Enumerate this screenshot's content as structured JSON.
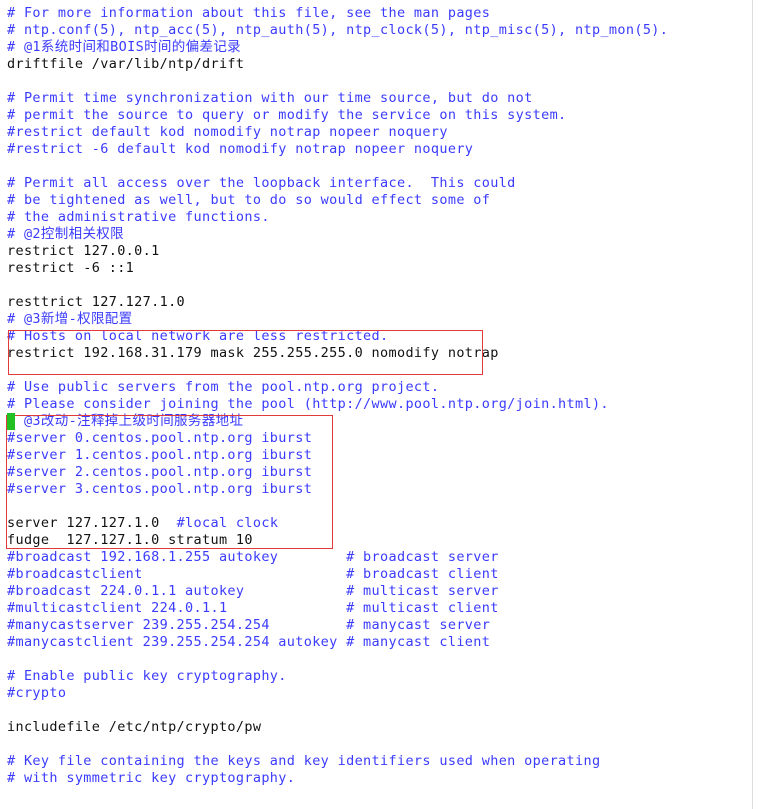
{
  "editor": {
    "lines": [
      {
        "kind": "comment",
        "text": "# For more information about this file, see the man pages"
      },
      {
        "kind": "comment",
        "text": "# ntp.conf(5), ntp_acc(5), ntp_auth(5), ntp_clock(5), ntp_misc(5), ntp_mon(5)."
      },
      {
        "kind": "comment",
        "text": "# @1系统时间和BOIS时间的偏差记录"
      },
      {
        "kind": "plain",
        "text": "driftfile /var/lib/ntp/drift"
      },
      {
        "kind": "blank",
        "text": ""
      },
      {
        "kind": "comment",
        "text": "# Permit time synchronization with our time source, but do not"
      },
      {
        "kind": "comment",
        "text": "# permit the source to query or modify the service on this system."
      },
      {
        "kind": "comment",
        "text": "#restrict default kod nomodify notrap nopeer noquery"
      },
      {
        "kind": "comment",
        "text": "#restrict -6 default kod nomodify notrap nopeer noquery"
      },
      {
        "kind": "blank",
        "text": ""
      },
      {
        "kind": "comment",
        "text": "# Permit all access over the loopback interface.  This could"
      },
      {
        "kind": "comment",
        "text": "# be tightened as well, but to do so would effect some of"
      },
      {
        "kind": "comment",
        "text": "# the administrative functions."
      },
      {
        "kind": "comment",
        "text": "# @2控制相关权限"
      },
      {
        "kind": "plain",
        "text": "restrict 127.0.0.1"
      },
      {
        "kind": "plain",
        "text": "restrict -6 ::1"
      },
      {
        "kind": "blank",
        "text": ""
      },
      {
        "kind": "plain",
        "text": "resttrict 127.127.1.0"
      },
      {
        "kind": "comment",
        "text": "# @3新增-权限配置"
      },
      {
        "kind": "comment",
        "text": "# Hosts on local network are less restricted."
      },
      {
        "kind": "plain",
        "text": "restrict 192.168.31.179 mask 255.255.255.0 nomodify notrap"
      },
      {
        "kind": "blank",
        "text": ""
      },
      {
        "kind": "comment",
        "text": "# Use public servers from the pool.ntp.org project."
      },
      {
        "kind": "comment",
        "text": "# Please consider joining the pool (http://www.pool.ntp.org/join.html)."
      },
      {
        "kind": "comment",
        "text": "# @3改动-注释掉上级时间服务器地址"
      },
      {
        "kind": "comment",
        "text": "#server 0.centos.pool.ntp.org iburst"
      },
      {
        "kind": "comment",
        "text": "#server 1.centos.pool.ntp.org iburst"
      },
      {
        "kind": "comment",
        "text": "#server 2.centos.pool.ntp.org iburst"
      },
      {
        "kind": "comment",
        "text": "#server 3.centos.pool.ntp.org iburst"
      },
      {
        "kind": "blank",
        "text": ""
      },
      {
        "kind": "mixed",
        "text": "server 127.127.1.0  ",
        "comment": "#local clock"
      },
      {
        "kind": "plain",
        "text": "fudge  127.127.1.0 stratum 10"
      },
      {
        "kind": "comment",
        "text": "#broadcast 192.168.1.255 autokey        # broadcast server"
      },
      {
        "kind": "comment",
        "text": "#broadcastclient                        # broadcast client"
      },
      {
        "kind": "comment",
        "text": "#broadcast 224.0.1.1 autokey            # multicast server"
      },
      {
        "kind": "comment",
        "text": "#multicastclient 224.0.1.1              # multicast client"
      },
      {
        "kind": "comment",
        "text": "#manycastserver 239.255.254.254         # manycast server"
      },
      {
        "kind": "comment",
        "text": "#manycastclient 239.255.254.254 autokey # manycast client"
      },
      {
        "kind": "blank",
        "text": ""
      },
      {
        "kind": "comment",
        "text": "# Enable public key cryptography."
      },
      {
        "kind": "comment",
        "text": "#crypto"
      },
      {
        "kind": "blank",
        "text": ""
      },
      {
        "kind": "plain",
        "text": "includefile /etc/ntp/crypto/pw"
      },
      {
        "kind": "blank",
        "text": ""
      },
      {
        "kind": "comment",
        "text": "# Key file containing the keys and key identifiers used when operating"
      },
      {
        "kind": "comment",
        "text": "# with symmetric key cryptography."
      }
    ]
  },
  "colors": {
    "comment": "#3b3bff",
    "text": "#111111",
    "highlight_box": "#e03a3a",
    "cursor": "#22c022",
    "background": "#ffffff"
  }
}
